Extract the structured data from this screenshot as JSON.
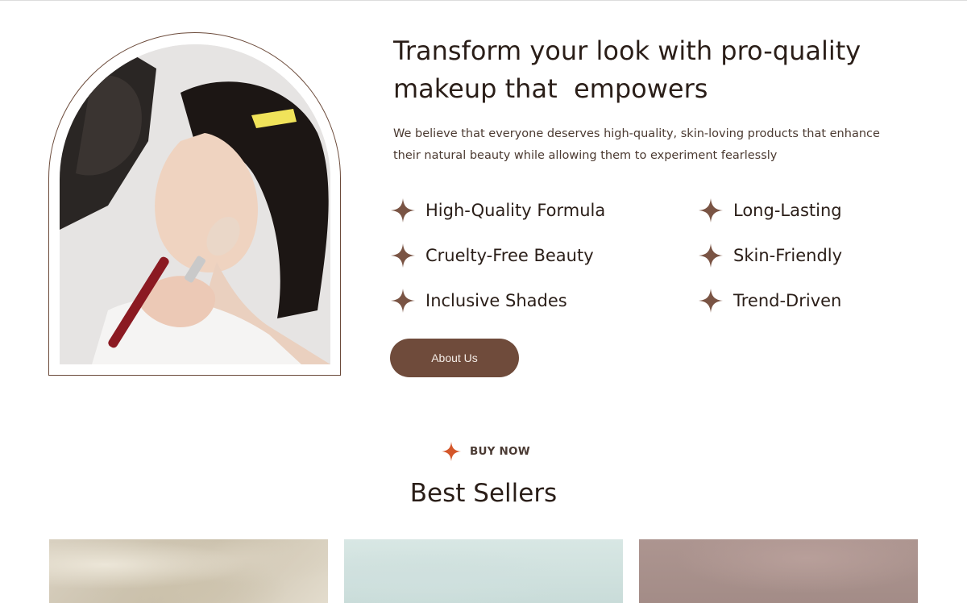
{
  "hero": {
    "headline_line1": "Transform your look with pro-quality",
    "headline_line2": "makeup that  empowers",
    "description": "We believe that everyone deserves high-quality, skin-loving products that enhance their natural beauty while allowing them to experiment fearlessly",
    "features": [
      {
        "label": "High-Quality Formula"
      },
      {
        "label": "Long-Lasting"
      },
      {
        "label": "Cruelty-Free Beauty"
      },
      {
        "label": "Skin-Friendly"
      },
      {
        "label": "Inclusive Shades"
      },
      {
        "label": "Trend-Driven"
      }
    ],
    "cta_label": "About Us",
    "image_alt": "makeup artist applying blush brush to woman with hair clip"
  },
  "best_sellers": {
    "eyebrow": "BUY NOW",
    "title": "Best Sellers"
  },
  "colors": {
    "accent_brown": "#6f4b3b",
    "star_brown": "#7a5444",
    "star_orange": "#d4572a",
    "text_dark": "#2a1e18"
  },
  "icons": {
    "feature_star": "four-point-star-icon",
    "eyebrow_star": "four-point-star-icon"
  }
}
